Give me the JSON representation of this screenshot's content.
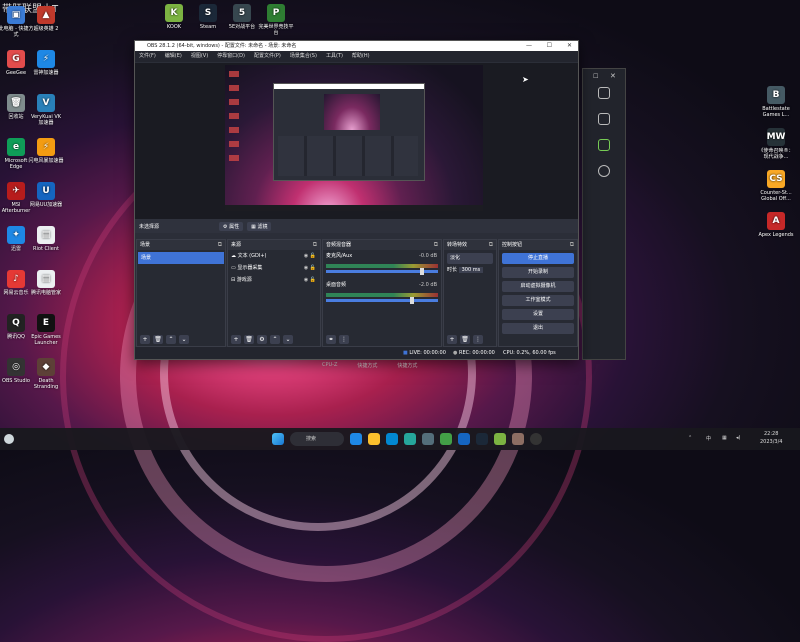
{
  "overlay_title": "带肝联盟小T",
  "desktop": {
    "left_icons": [
      {
        "label": "此电脑 - 快捷方式",
        "color": "#3a7bd5",
        "glyph": "▣"
      },
      {
        "label": "超级英雄 2",
        "color": "#c0392b",
        "glyph": "▲"
      },
      {
        "label": "GeeGee",
        "color": "#e24c4c",
        "glyph": "G"
      },
      {
        "label": "雷神加速器",
        "color": "#1e88e5",
        "glyph": "⚡"
      },
      {
        "label": "回收站",
        "color": "#7f8c8d",
        "glyph": "🗑"
      },
      {
        "label": "VeryKuai VK 加速器",
        "color": "#2980b9",
        "glyph": "V"
      },
      {
        "label": "Microsoft Edge",
        "color": "#0f9d58",
        "glyph": "e"
      },
      {
        "label": "闪电风暴加速器",
        "color": "#f39c12",
        "glyph": "⚡"
      },
      {
        "label": "MSI Afterburner",
        "color": "#b71c1c",
        "glyph": "✈"
      },
      {
        "label": "网易UU加速器",
        "color": "#1565c0",
        "glyph": "U"
      },
      {
        "label": "迅雷",
        "color": "#1e88e5",
        "glyph": "✦"
      },
      {
        "label": "Riot Client",
        "color": "#eceff1",
        "glyph": "▤"
      },
      {
        "label": "网易云音乐",
        "color": "#e53935",
        "glyph": "♪"
      },
      {
        "label": "腾讯电脑管家",
        "color": "#eceff1",
        "glyph": "▤"
      },
      {
        "label": "腾讯QQ",
        "color": "#222",
        "glyph": "Q"
      },
      {
        "label": "Epic Games Launcher",
        "color": "#111",
        "glyph": "E"
      },
      {
        "label": "OBS Studio",
        "color": "#333",
        "glyph": "◎"
      },
      {
        "label": "Death Stranding",
        "color": "#5d4037",
        "glyph": "◆"
      }
    ],
    "top_icons": [
      {
        "label": "KOOK",
        "color": "#7cb342",
        "glyph": "K"
      },
      {
        "label": "Steam",
        "color": "#1b2838",
        "glyph": "S"
      },
      {
        "label": "5E对战平台",
        "color": "#37474f",
        "glyph": "5"
      },
      {
        "label": "完美世界竞技平台",
        "color": "#2e7d32",
        "glyph": "P"
      }
    ],
    "right_icons": [
      {
        "label": "Battlestate Games L...",
        "color": "#455a64",
        "glyph": "B"
      },
      {
        "label": "《使命召唤®：现代战争...",
        "color": "#263238",
        "glyph": "MW"
      },
      {
        "label": "Counter-St... Global Off...",
        "color": "#f9a825",
        "glyph": "CS"
      },
      {
        "label": "Apex Legends",
        "color": "#c62828",
        "glyph": "A"
      }
    ]
  },
  "obs": {
    "title": "OBS 28.1.2 (64-bit, windows) - 配置文件: 未命名 - 场景: 未命名",
    "window_controls": [
      "—",
      "☐",
      "✕"
    ],
    "menu": [
      "文件(F)",
      "编辑(E)",
      "视图(V)",
      "停靠窗口(D)",
      "配置文件(P)",
      "场景集合(S)",
      "工具(T)",
      "帮助(H)"
    ],
    "source_bar": {
      "label": "未选择源",
      "props": "属性",
      "filters": "滤镜"
    },
    "scenes": {
      "title": "场景",
      "items": [
        "场景"
      ]
    },
    "sources": {
      "title": "来源",
      "items": [
        "文本 (GDI+)",
        "显示器采集",
        "游戏源"
      ]
    },
    "mixer": {
      "title": "音频混音器",
      "channels": [
        {
          "name": "麦克风/Aux",
          "db": "-0.0 dB"
        },
        {
          "name": "桌面音频",
          "db": "-2.0 dB"
        }
      ]
    },
    "transitions": {
      "title": "转场特效",
      "type": "淡化",
      "duration_label": "时长",
      "duration": "300 ms"
    },
    "controls": {
      "title": "控制按钮",
      "buttons": [
        "停止直播",
        "开始录制",
        "启动虚拟摄像机",
        "工作室模式",
        "设置",
        "退出"
      ]
    },
    "status": {
      "live": "LIVE: 00:00:00",
      "rec": "REC: 00:00:00",
      "cpu": "CPU: 0.2%, 60.00 fps"
    }
  },
  "behind_window_labels": [
    "CPU-Z",
    "快捷方式",
    "快捷方式"
  ],
  "taskbar": {
    "search": "搜索",
    "tray_ime": "中",
    "tray_time": "22:28",
    "tray_date": "2023/3/4"
  },
  "colors": {
    "accent": "#3f73d6",
    "obs_bg": "#2b2e38"
  }
}
